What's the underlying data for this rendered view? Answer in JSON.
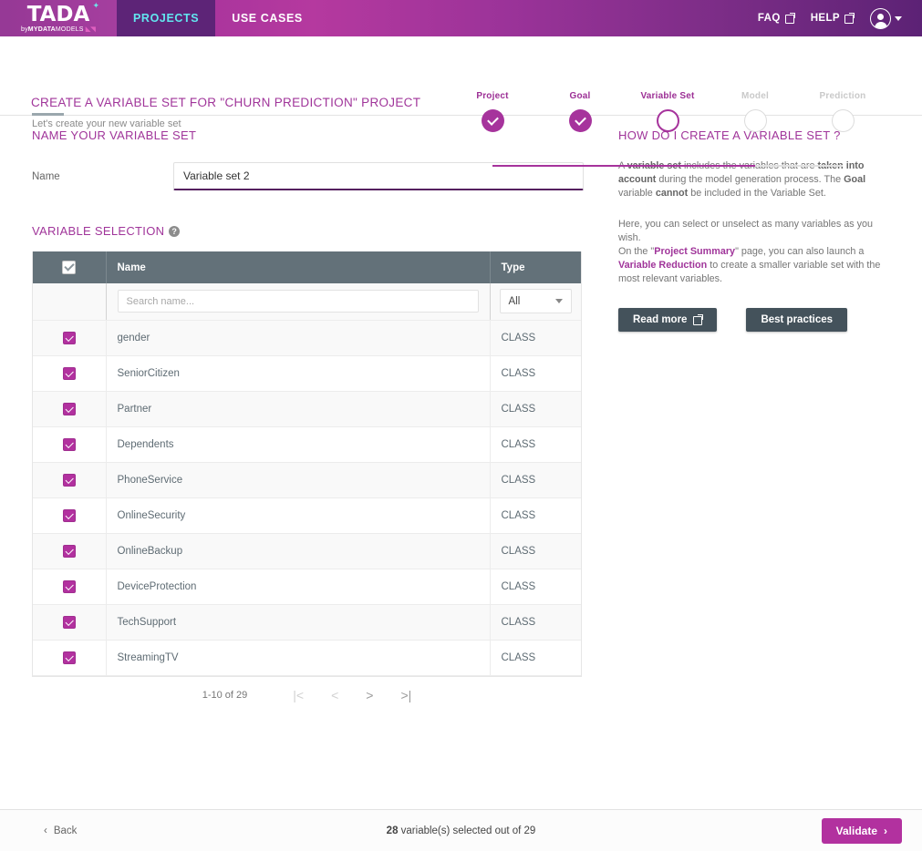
{
  "topnav": {
    "logo_main": "TADA",
    "logo_main_accent": "A",
    "logo_sub_by": "by",
    "logo_sub_bold": "MYDATA",
    "logo_sub_thin": "MODELS",
    "tabs": [
      {
        "label": "PROJECTS",
        "active": true
      },
      {
        "label": "USE CASES",
        "active": false
      }
    ],
    "links": [
      {
        "label": "FAQ",
        "icon": "external-link-icon"
      },
      {
        "label": "HELP",
        "icon": "external-link-icon"
      }
    ],
    "account_icon": "user-avatar-icon",
    "account_caret": "chevron-down-icon"
  },
  "page": {
    "title": "CREATE A VARIABLE SET FOR \"CHURN PREDICTION\" PROJECT",
    "subtitle": "Let's create your new variable set"
  },
  "stepper": {
    "steps": [
      {
        "label": "Project",
        "state": "done"
      },
      {
        "label": "Goal",
        "state": "done"
      },
      {
        "label": "Variable Set",
        "state": "current"
      },
      {
        "label": "Model",
        "state": "pending"
      },
      {
        "label": "Prediction",
        "state": "pending"
      }
    ]
  },
  "name_section": {
    "heading": "NAME YOUR VARIABLE SET",
    "label": "Name",
    "value": "Variable set 2",
    "placeholder": ""
  },
  "variable_selection": {
    "heading": "VARIABLE SELECTION",
    "help_icon": "question-mark-icon",
    "columns": {
      "name": "Name",
      "type": "Type"
    },
    "search_placeholder": "Search name...",
    "search_value": "",
    "type_filter_value": "All",
    "header_checkbox_checked": true,
    "rows": [
      {
        "name": "gender",
        "type": "CLASS",
        "checked": true
      },
      {
        "name": "SeniorCitizen",
        "type": "CLASS",
        "checked": true
      },
      {
        "name": "Partner",
        "type": "CLASS",
        "checked": true
      },
      {
        "name": "Dependents",
        "type": "CLASS",
        "checked": true
      },
      {
        "name": "PhoneService",
        "type": "CLASS",
        "checked": true
      },
      {
        "name": "OnlineSecurity",
        "type": "CLASS",
        "checked": true
      },
      {
        "name": "OnlineBackup",
        "type": "CLASS",
        "checked": true
      },
      {
        "name": "DeviceProtection",
        "type": "CLASS",
        "checked": true
      },
      {
        "name": "TechSupport",
        "type": "CLASS",
        "checked": true
      },
      {
        "name": "StreamingTV",
        "type": "CLASS",
        "checked": true
      }
    ],
    "pagination": {
      "range_label": "1-10 of 29",
      "first_icon": "first-page-icon",
      "prev_icon": "previous-page-icon",
      "next_icon": "next-page-icon",
      "last_icon": "last-page-icon"
    }
  },
  "help_panel": {
    "title": "HOW DO I CREATE A VARIABLE SET ?",
    "paragraph1_html": "A <b>variable set</b> includes the variables that are <b>taken into account</b> during the model generation process. The <b>Goal</b> variable <b>cannot</b> be included in the Variable Set.",
    "paragraph2_html": "Here, you can select or unselect as many variables as you wish.<br>On the \"<span class='lnk'>Project Summary</span>\" page, you can also launch a <span class='lnk'>Variable Reduction</span> to create a smaller variable set with the most relevant variables.",
    "read_more_label": "Read more",
    "read_more_icon": "external-link-icon",
    "best_practices_label": "Best practices"
  },
  "footer": {
    "back_label": "Back",
    "back_icon": "chevron-left-icon",
    "status_count": "28",
    "status_text": " variable(s) selected out of 29",
    "validate_label": "Validate",
    "validate_icon": "chevron-right-icon"
  },
  "colors": {
    "brand_magenta": "#b2319f",
    "brand_purple": "#a0359a",
    "nav_active_purple": "#5d2477",
    "nav_active_text": "#62e5ef",
    "table_header_slate": "#637179",
    "dark_button": "#44525b"
  }
}
